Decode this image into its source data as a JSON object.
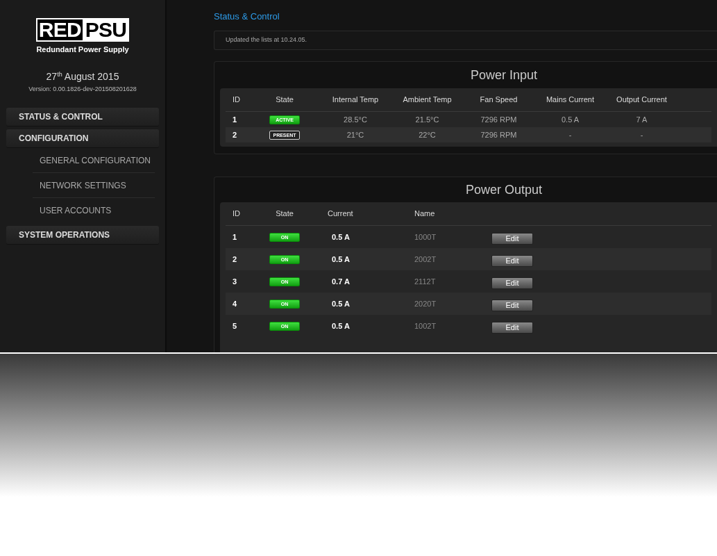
{
  "sidebar": {
    "logo": {
      "left": "RED",
      "right": "PSU",
      "tagline": "Redundant Power Supply"
    },
    "date": {
      "day": "27",
      "suffix": "th",
      "rest": "August 2015"
    },
    "version": "Version: 0.00.1826-dev-201508201628",
    "nav": [
      {
        "label": "STATUS & CONTROL"
      },
      {
        "label": "CONFIGURATION",
        "children": [
          {
            "label": "GENERAL CONFIGURATION"
          },
          {
            "label": "NETWORK SETTINGS"
          },
          {
            "label": "USER ACCOUNTS"
          }
        ]
      },
      {
        "label": "SYSTEM OPERATIONS"
      }
    ]
  },
  "page_title": "Status & Control",
  "notice": "Updated the lists at 10.24.05.",
  "power_input": {
    "title": "Power Input",
    "columns": [
      "ID",
      "State",
      "Internal Temp",
      "Ambient Temp",
      "Fan Speed",
      "Mains Current",
      "Output Current"
    ],
    "rows": [
      {
        "id": "1",
        "state": {
          "label": "ACTIVE",
          "kind": "filled"
        },
        "internal_temp": "28.5°C",
        "ambient_temp": "21.5°C",
        "fan_speed": "7296 RPM",
        "mains_current": "0.5 A",
        "output_current": "7 A"
      },
      {
        "id": "2",
        "state": {
          "label": "PRESENT",
          "kind": "outline"
        },
        "internal_temp": "21°C",
        "ambient_temp": "22°C",
        "fan_speed": "7296 RPM",
        "mains_current": "-",
        "output_current": "-"
      }
    ]
  },
  "power_output": {
    "title": "Power Output",
    "columns": [
      "ID",
      "State",
      "Current",
      "Name"
    ],
    "rows": [
      {
        "id": "1",
        "state": {
          "label": "ON",
          "kind": "filled"
        },
        "current": "0.5 A",
        "name": "1000T",
        "action": "Edit"
      },
      {
        "id": "2",
        "state": {
          "label": "ON",
          "kind": "filled"
        },
        "current": "0.5 A",
        "name": "2002T",
        "action": "Edit"
      },
      {
        "id": "3",
        "state": {
          "label": "ON",
          "kind": "filled"
        },
        "current": "0.7 A",
        "name": "2112T",
        "action": "Edit"
      },
      {
        "id": "4",
        "state": {
          "label": "ON",
          "kind": "filled"
        },
        "current": "0.5 A",
        "name": "2020T",
        "action": "Edit"
      },
      {
        "id": "5",
        "state": {
          "label": "ON",
          "kind": "filled"
        },
        "current": "0.5 A",
        "name": "1002T",
        "action": "Edit"
      }
    ]
  }
}
